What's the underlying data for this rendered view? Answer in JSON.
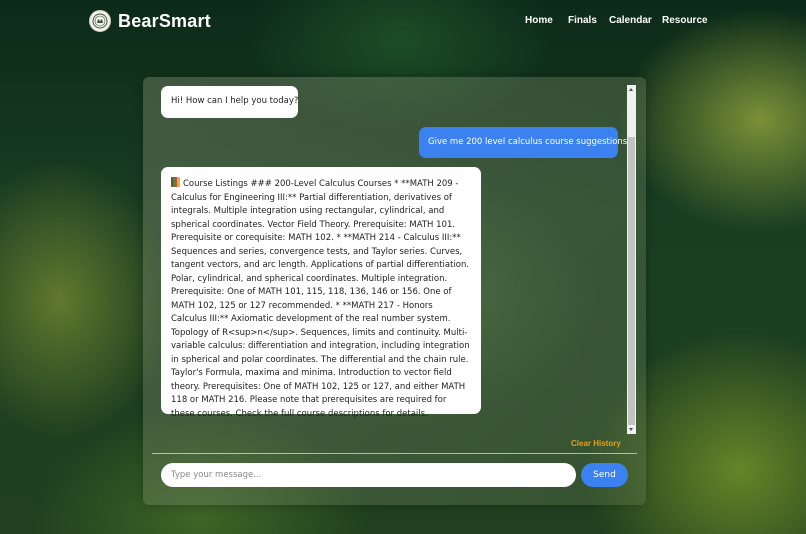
{
  "navbar": {
    "brand": "BearSmart",
    "logo_icon": "seal-logo-icon",
    "links": [
      "Home",
      "Finals",
      "Calendar",
      "Resource"
    ]
  },
  "chat": {
    "messages": [
      {
        "role": "bot",
        "text": "Hi! How can I help you today?"
      },
      {
        "role": "user",
        "text": "Give me 200 level calculus course suggestions"
      },
      {
        "role": "bot",
        "icon": "books-icon",
        "text": "Course Listings ### 200-Level Calculus Courses * **MATH 209 - Calculus for Engineering III:** Partial differentiation, derivatives of integrals. Multiple integration using rectangular, cylindrical, and spherical coordinates. Vector Field Theory. Prerequisite: MATH 101. Prerequisite or corequisite: MATH 102. * **MATH 214 - Calculus III:** Sequences and series, convergence tests, and Taylor series. Curves, tangent vectors, and arc length. Applications of partial differentiation. Polar, cylindrical, and spherical coordinates. Multiple integration. Prerequisite: One of MATH 101, 115, 118, 136, 146 or 156. One of MATH 102, 125 or 127 recommended. * **MATH 217 - Honors Calculus III:** Axiomatic development of the real number system. Topology of R<sup>n</sup>. Sequences, limits and continuity. Multi-variable calculus: differentiation and integration, including integration in spherical and polar coordinates. The differential and the chain rule. Taylor's Formula, maxima and minima. Introduction to vector field theory. Prerequisites: One of MATH 102, 125 or 127, and either MATH 118 or MATH 216. Please note that prerequisites are required for these courses. Check the full course descriptions for details."
      }
    ],
    "clear_history_label": "Clear History",
    "input_placeholder": "Type your message...",
    "input_value": "",
    "send_label": "Send"
  },
  "colors": {
    "accent_blue": "#3b82f0",
    "clear_history": "#e0a020",
    "bot_bubble": "#ffffff"
  }
}
